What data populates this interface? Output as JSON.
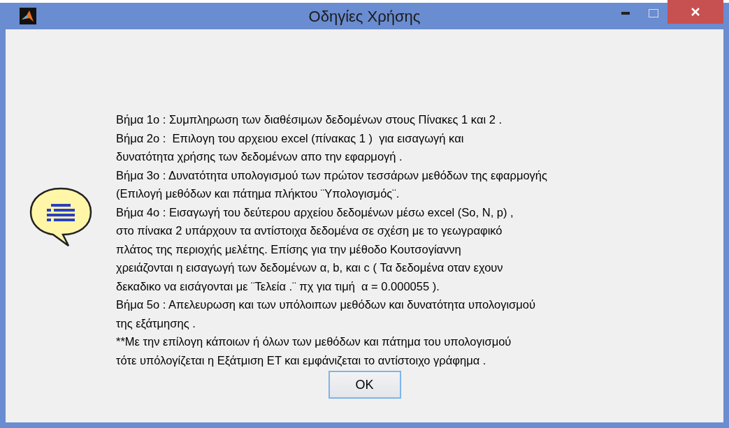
{
  "window": {
    "title": "Οδηγίες Χρήσης"
  },
  "lines": [
    "Βήμα 1ο : Συμπληρωση των διαθέσιμων δεδομένων στους Πίνακες 1 και 2 .",
    "Βήμα 2ο :  Επιλογη του αρχειου excel (πίνακας 1 )  για εισαγωγή και",
    "δυνατότητα χρήσης των δεδομένων απο την εφαρμογή .",
    "Βήμα 3ο : Δυνατότητα υπολογισμού των πρώτον τεσσάρων μεθόδων της εφαρμογής",
    "(Επιλογή μεθόδων και πάτημα πλήκτου ¨Υπολογισμός¨.",
    "Βήμα 4ο : Εισαγωγή του δεύτερου αρχείου δεδομένων μέσω excel (So, N, p) ,",
    "στο πίνακα 2 υπάρχουν τα αντίστοιχα δεδομένα σε σχέση με το γεωγραφικό",
    "πλάτος της περιοχής μελέτης. Επίσης για την μέθοδο Κουτσογίαννη",
    "χρειάζονται η εισαγωγή των δεδομένων α, b, και c ( Τα δεδομένα οταν εχουν",
    "δεκαδικο να εισάγονται με ¨Τελεία .¨ πχ για τιμή  α = 0.000055 ).",
    "Βήμα 5ο : Απελευρωση και των υπόλοιπων μεθόδων και δυνατότητα υπολογισμού",
    "της εξάτμησης .",
    "**Με την επίλογη κάποιων ή όλων των μεθόδων και πάτημα του υπολογισμού",
    "τότε υπόλογίζεται η Εξάτμιση ΕΤ και εμφάνιζεται το αντίστοιχο γράφημα ."
  ],
  "buttons": [
    {
      "label": "OK"
    }
  ]
}
